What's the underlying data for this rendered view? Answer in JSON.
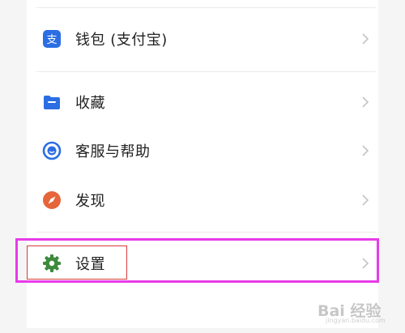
{
  "menu": [
    {
      "label": "钱包 (支付宝)",
      "icon": "alipay-icon",
      "color": "#2b6ee3"
    },
    {
      "label": "收藏",
      "icon": "folder-icon",
      "color": "#2b6ee3"
    },
    {
      "label": "客服与帮助",
      "icon": "headset-icon",
      "color": "#2b6ee3"
    },
    {
      "label": "发现",
      "icon": "compass-icon",
      "color": "#e6653a"
    },
    {
      "label": "设置",
      "icon": "gear-icon",
      "color": "#3d8a3d"
    }
  ],
  "highlight_colors": {
    "outer": "#e83be8",
    "inner": "#d93a3a"
  },
  "watermark": {
    "text": "Bai 经验",
    "sub": "jingyan.baidu.com"
  }
}
